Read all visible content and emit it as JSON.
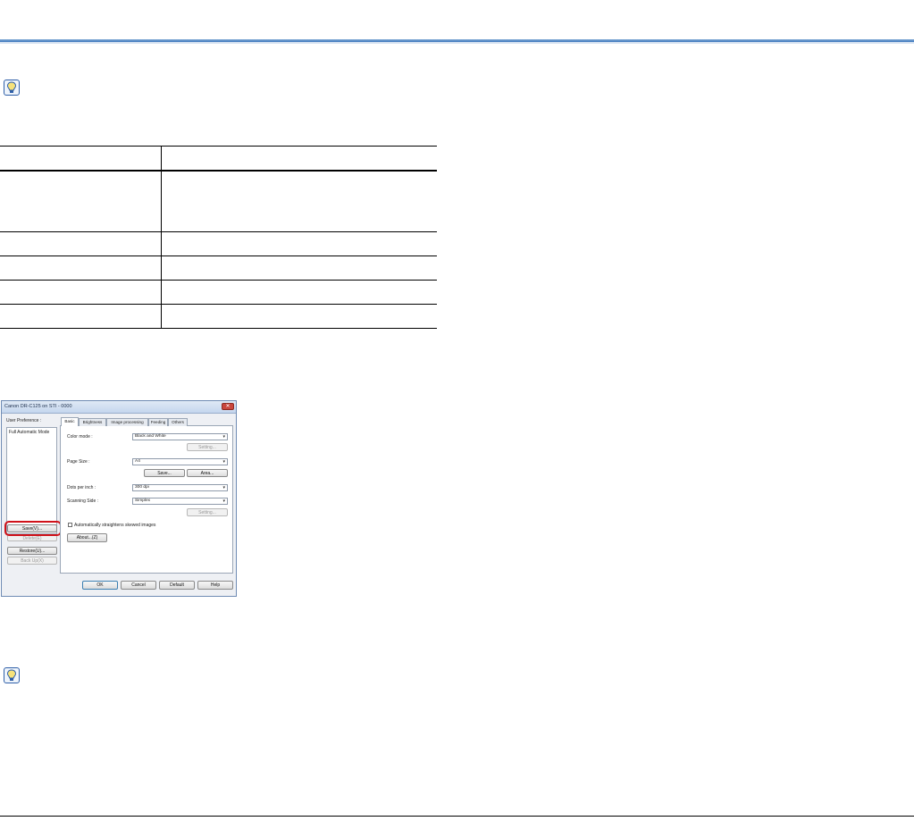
{
  "colors": {
    "accent_rule": "#3f79bd",
    "highlight": "#d0121a"
  },
  "icons": {
    "tip_top": "lightbulb-hint-icon",
    "tip_bottom": "lightbulb-hint-icon"
  },
  "dialog": {
    "title": "Canon DR-C125 on STI - 0000",
    "close_label": "✕",
    "user_preference_label": "User Preference :",
    "preference_items": [
      "Full Automatic Mode"
    ],
    "buttons_left": {
      "save": "Save(V)...",
      "delete": "Delete(E)",
      "restore": "Restore(U)...",
      "backup": "Back Up(X)"
    },
    "tabs": [
      "Basic",
      "Brightness",
      "Image processing",
      "Feeding",
      "Others"
    ],
    "color_mode_label": "Color mode :",
    "color_mode_value": "Black and White",
    "setting_button_1": "Setting...",
    "page_size_label": "Page Size :",
    "page_size_value": "A4",
    "save_button": "Save...",
    "area_button": "Area...",
    "dpi_label": "Dots per inch :",
    "dpi_value": "300 dpi",
    "scanning_side_label": "Scanning Side :",
    "scanning_side_value": "Simplex",
    "setting_button_2": "Setting...",
    "straighten_label": "Automatically straightens skewed images",
    "about_button": "About...(Z)",
    "ok": "OK",
    "cancel": "Cancel",
    "default": "Default",
    "help": "Help"
  }
}
